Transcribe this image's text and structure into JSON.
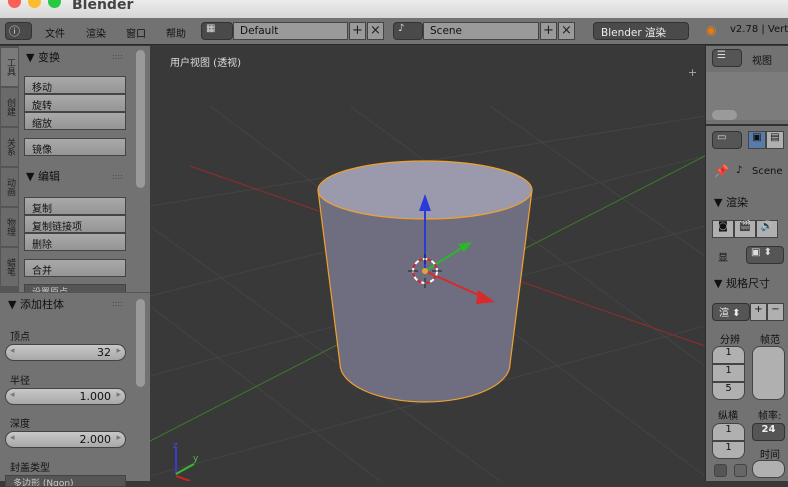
{
  "window": {
    "title": "Blender"
  },
  "menu": {
    "items": [
      "文件",
      "渲染",
      "窗口",
      "帮助"
    ],
    "layout": "Default",
    "scene": "Scene",
    "engine": "Blender 渲染",
    "version": "v2.78 | Vert"
  },
  "left_tabs": [
    "工具",
    "创建",
    "关系",
    "动画",
    "物理",
    "蜡笔"
  ],
  "transform": {
    "title": "变换",
    "buttons": [
      "移动",
      "旋转",
      "缩放"
    ],
    "mirror": "镜像"
  },
  "edit": {
    "title": "编辑",
    "buttons": [
      "复制",
      "复制链接项",
      "删除"
    ],
    "join": "合并",
    "truncated": "设置原点"
  },
  "add_cylinder": {
    "title": "添加柱体",
    "vertices_label": "顶点",
    "vertices": "32",
    "radius_label": "半径",
    "radius": "1.000",
    "depth_label": "深度",
    "depth": "2.000",
    "cap_label": "封盖类型",
    "cap_value": "多边形 (Ngon)"
  },
  "viewport": {
    "label": "用户视图 (透视)",
    "axis_z": "z",
    "axis_y": "y"
  },
  "right": {
    "view": "视图",
    "scene": "Scene",
    "render": "渲染",
    "display": "显",
    "dimensions": "规格尺寸",
    "preset": "渲",
    "resolution": "分辨",
    "frame_range": "帧范",
    "res_values": [
      "1",
      "1",
      "5"
    ],
    "aspect": "纵横",
    "aspect_values": [
      "1",
      "1"
    ],
    "fps_label": "帧率:",
    "fps": "24",
    "time": "时间"
  }
}
